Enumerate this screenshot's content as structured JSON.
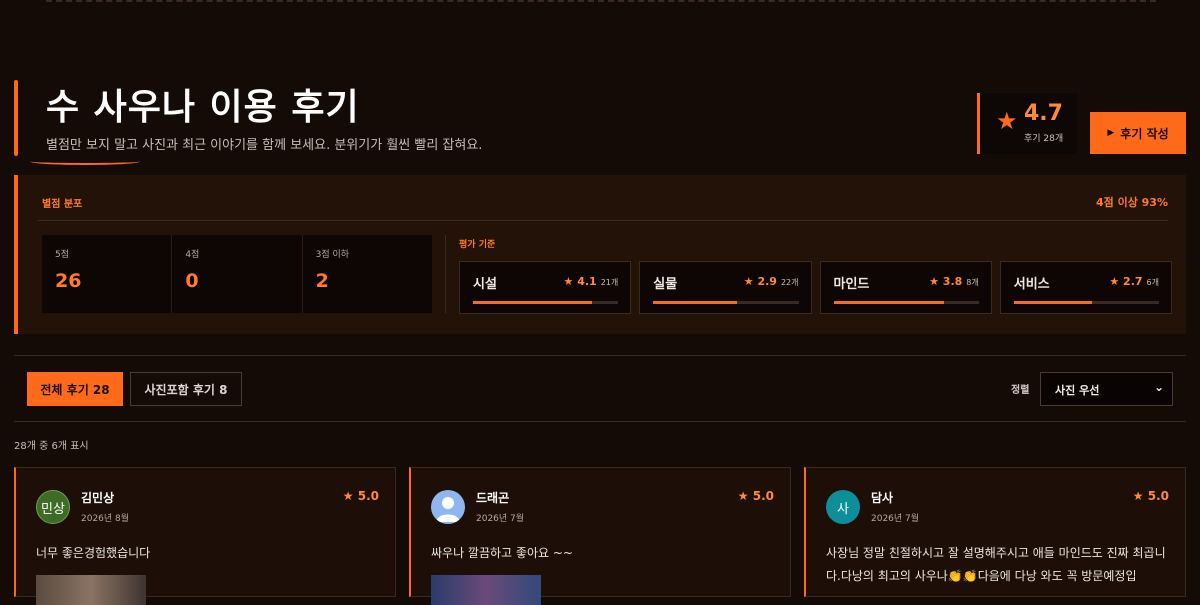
{
  "header": {
    "title": "수 사우나 이용 후기",
    "subtitle": "별점만 보지 말고 사진과 최근 이야기를 함께 보세요. 분위기가 훨씬 빨리 잡혀요.",
    "rating": "4.7",
    "review_count": "후기 28개",
    "write_button": "후기 작성"
  },
  "distribution": {
    "label": "별점 분포",
    "ratio": "4점 이상 93%",
    "groups": [
      {
        "label": "5점",
        "count": "26"
      },
      {
        "label": "4점",
        "count": "0"
      },
      {
        "label": "3점 이하",
        "count": "2"
      }
    ],
    "criteria_label": "평가 기준",
    "criteria": [
      {
        "name": "시설",
        "score": "★ 4.1",
        "count": "21개",
        "fill": 0.82
      },
      {
        "name": "실물",
        "score": "★ 2.9",
        "count": "22개",
        "fill": 0.58
      },
      {
        "name": "마인드",
        "score": "★ 3.8",
        "count": "8개",
        "fill": 0.76
      },
      {
        "name": "서비스",
        "score": "★ 2.7",
        "count": "6개",
        "fill": 0.54
      }
    ]
  },
  "tabs": {
    "all": "전체 후기 28",
    "photo": "사진포함 후기 8"
  },
  "sort": {
    "label": "정렬",
    "value": "사진 우선"
  },
  "result_count": "28개 중 6개 표시",
  "reviews": [
    {
      "avatar_text": "민상",
      "name": "김민상",
      "date": "2026년 8월",
      "score": "★ 5.0",
      "text": "너무 좋은경험했습니다"
    },
    {
      "avatar_text": "",
      "name": "드래곤",
      "date": "2026년 7월",
      "score": "★ 5.0",
      "text": "싸우나 깔끔하고 좋아요 ~~"
    },
    {
      "avatar_text": "사",
      "name": "담사",
      "date": "2026년 7월",
      "score": "★ 5.0",
      "text": "사장님 정말 친절하시고 잘 설명해주시고 애들 마인드도 진짜 최곱니다.다낭의 최고의 사우나👏👏다음에 다낭 와도 꼭 방문예정입"
    }
  ],
  "colors": {
    "accent": "#ff6a1a",
    "background": "#140b07",
    "panel": "#221208"
  }
}
